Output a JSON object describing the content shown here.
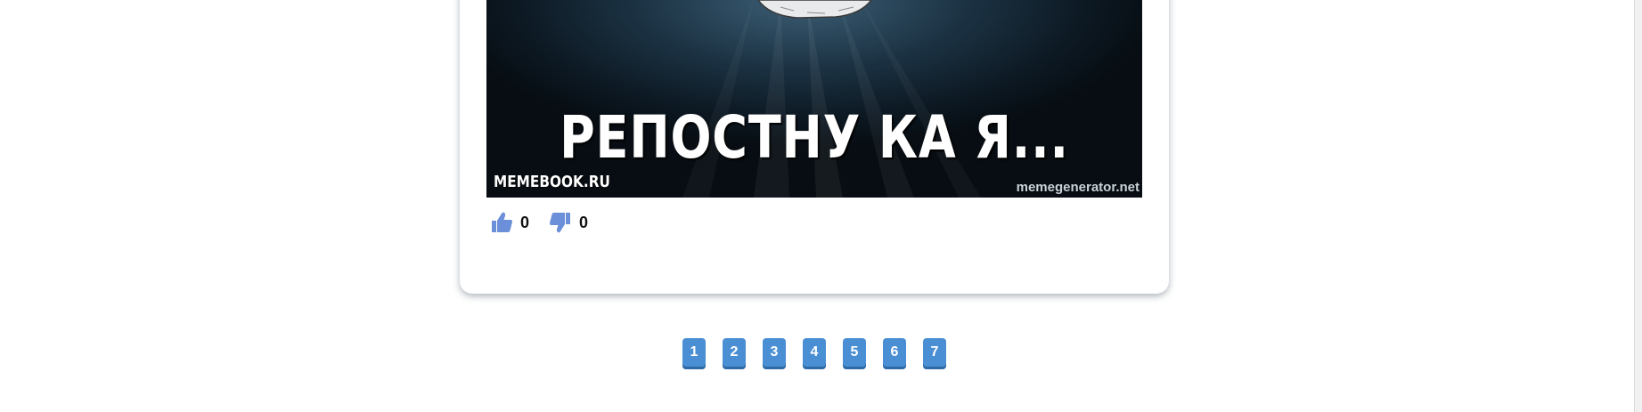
{
  "post": {
    "image": {
      "caption": "РЕПОСТНУ КА Я...",
      "watermark_left": "MEMEBOOK.RU",
      "watermark_right": "memegenerator.net"
    },
    "votes": {
      "like_icon": "thumbs-up-icon",
      "like_count": "0",
      "dislike_icon": "thumbs-down-icon",
      "dislike_count": "0",
      "icon_color": "#6b8fd8"
    }
  },
  "pagination": {
    "pages": [
      "1",
      "2",
      "3",
      "4",
      "5",
      "6",
      "7"
    ],
    "button_color": "#4a8fd3"
  }
}
